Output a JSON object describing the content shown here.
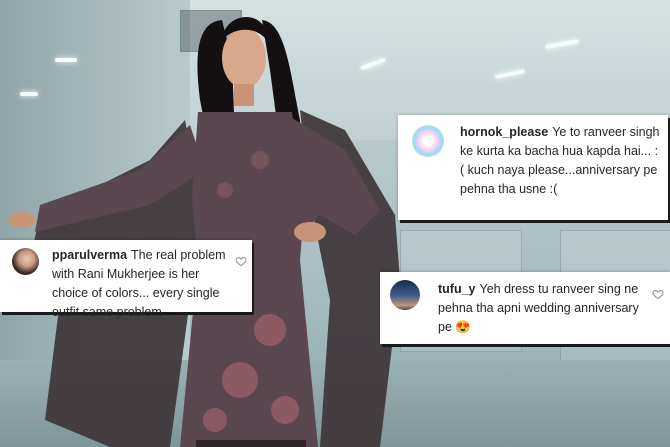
{
  "photo": {
    "description_icon": "portrait-photo",
    "colors": {
      "outfit": "#5a4750",
      "dupatta": "#3e3538",
      "background": "#b6c8ca"
    }
  },
  "comments": [
    {
      "username": "hornok_please",
      "text": "Ye to ranveer singh ke kurta ka bacha hua kapda hai... :( kuch naya please...anniversary pe pehna tha usne :(",
      "avatar": "flower-avatar-icon"
    },
    {
      "username": "pparulverma",
      "text": "The real problem with Rani Mukherjee is her choice of colors... every single outfit same problem",
      "avatar": "user-avatar-icon"
    },
    {
      "username": "tufu_y",
      "text": "Yeh dress tu ranveer sing ne pehna tha apni wedding anniversary pe 😍",
      "avatar": "sky-avatar-icon"
    }
  ]
}
